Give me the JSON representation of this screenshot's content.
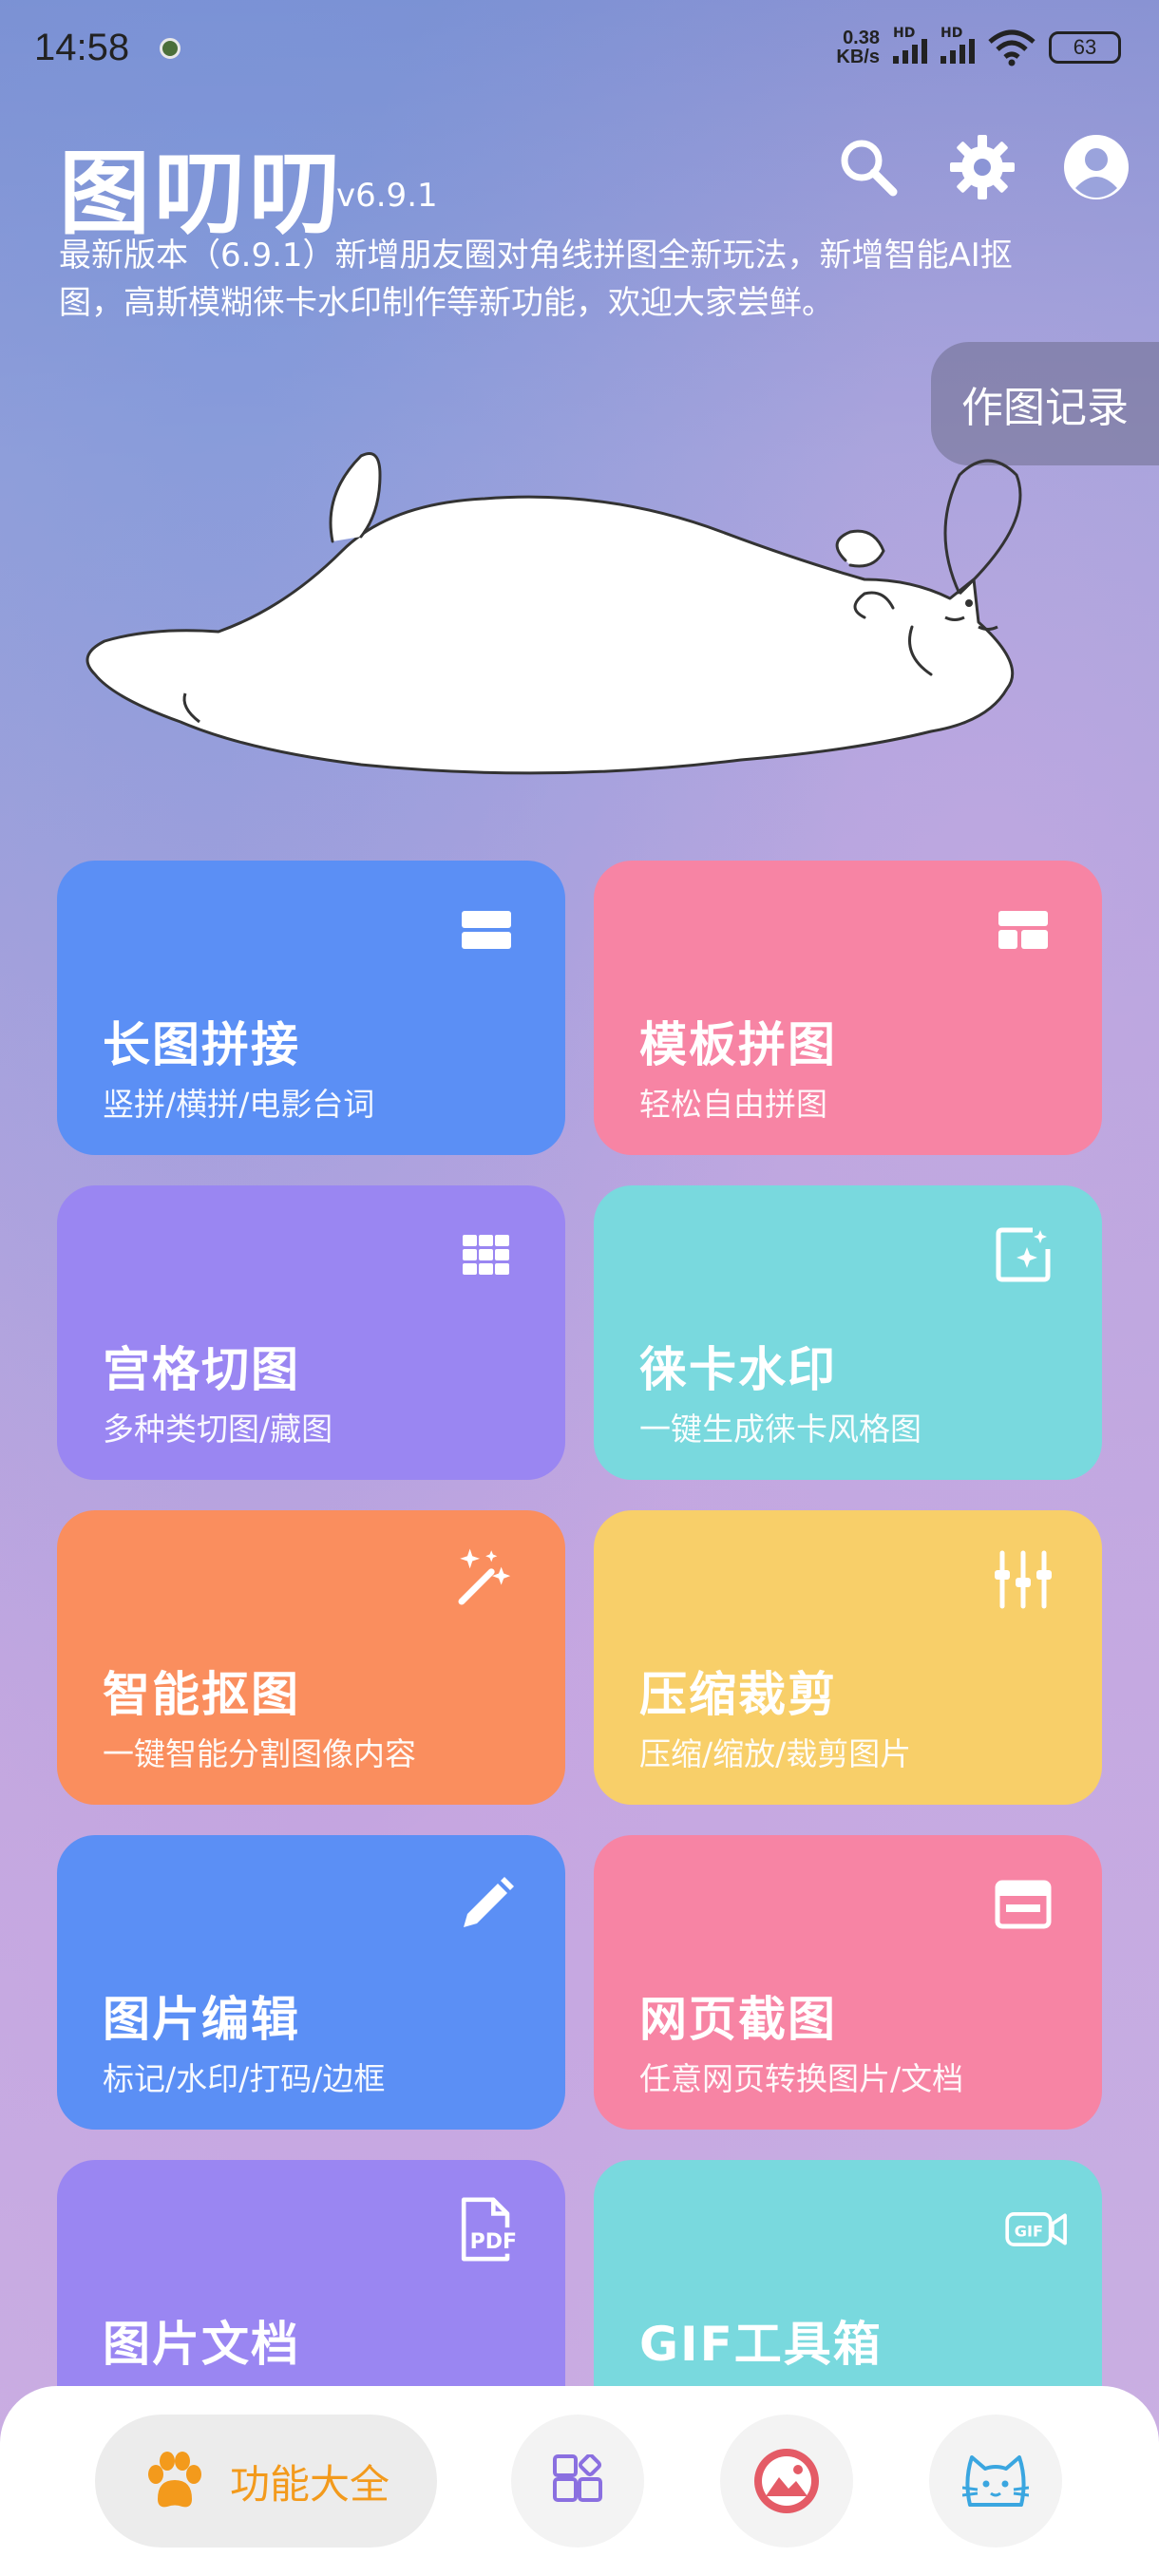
{
  "status_bar": {
    "time": "14:58",
    "net_speed_value": "0.38",
    "net_speed_unit": "KB/s",
    "signal_label": "HD",
    "battery": "63"
  },
  "header": {
    "title": "图叨叨",
    "version": "v6.9.1",
    "announcement": "最新版本（6.9.1）新增朋友圈对角线拼图全新玩法，新增智能AI抠图，高斯模糊徕卡水印制作等新功能，欢迎大家尝鲜。",
    "icons": [
      "search-icon",
      "gear-icon",
      "user-icon"
    ]
  },
  "record_tab": {
    "label": "作图记录"
  },
  "colors": {
    "blue": "#5b8ff5",
    "pink": "#f784a4",
    "purple": "#9a86f2",
    "cyan": "#79d9de",
    "orange": "#fa8e5e",
    "yellow": "#f8cf69",
    "nav_accent": "#f39a1c"
  },
  "cards": [
    {
      "title": "长图拼接",
      "subtitle": "竖拼/横拼/电影台词",
      "icon": "stack-layout-icon"
    },
    {
      "title": "模板拼图",
      "subtitle": "轻松自由拼图",
      "icon": "template-layout-icon"
    },
    {
      "title": "宫格切图",
      "subtitle": "多种类切图/藏图",
      "icon": "grid-icon"
    },
    {
      "title": "徕卡水印",
      "subtitle": "一键生成徕卡风格图",
      "icon": "sparkle-frame-icon"
    },
    {
      "title": "智能抠图",
      "subtitle": "一键智能分割图像内容",
      "icon": "magic-wand-icon"
    },
    {
      "title": "压缩裁剪",
      "subtitle": "压缩/缩放/裁剪图片",
      "icon": "sliders-icon"
    },
    {
      "title": "图片编辑",
      "subtitle": "标记/水印/打码/边框",
      "icon": "pencil-icon"
    },
    {
      "title": "网页截图",
      "subtitle": "任意网页转换图片/文档",
      "icon": "browser-window-icon"
    },
    {
      "title": "图片文档",
      "subtitle": "",
      "icon": "pdf-icon",
      "icon_text": "PDF"
    },
    {
      "title": "GIF工具箱",
      "subtitle": "",
      "icon": "gif-icon",
      "icon_text": "GIF"
    }
  ],
  "bottom_nav": {
    "main_label": "功能大全",
    "main_icon": "paw-icon",
    "other_icons": [
      "apps-icon",
      "gallery-icon",
      "cat-face-icon"
    ]
  }
}
